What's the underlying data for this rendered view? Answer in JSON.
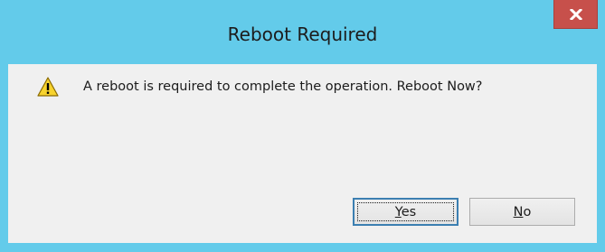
{
  "window": {
    "title": "Reboot Required",
    "close_glyph": "x",
    "close_icon": "close-icon"
  },
  "message": {
    "icon": "warning-icon",
    "text": "A reboot is required to complete the operation. Reboot Now?"
  },
  "buttons": {
    "yes": {
      "label": "Yes",
      "mnemonic": "Y",
      "rest": "es",
      "focused": true
    },
    "no": {
      "label": "No",
      "mnemonic": "N",
      "rest": "o",
      "focused": false
    }
  },
  "colors": {
    "frame": "#63cbea",
    "close": "#c7504b",
    "client": "#f0f0f0",
    "warning_fill": "#f7d32e"
  }
}
